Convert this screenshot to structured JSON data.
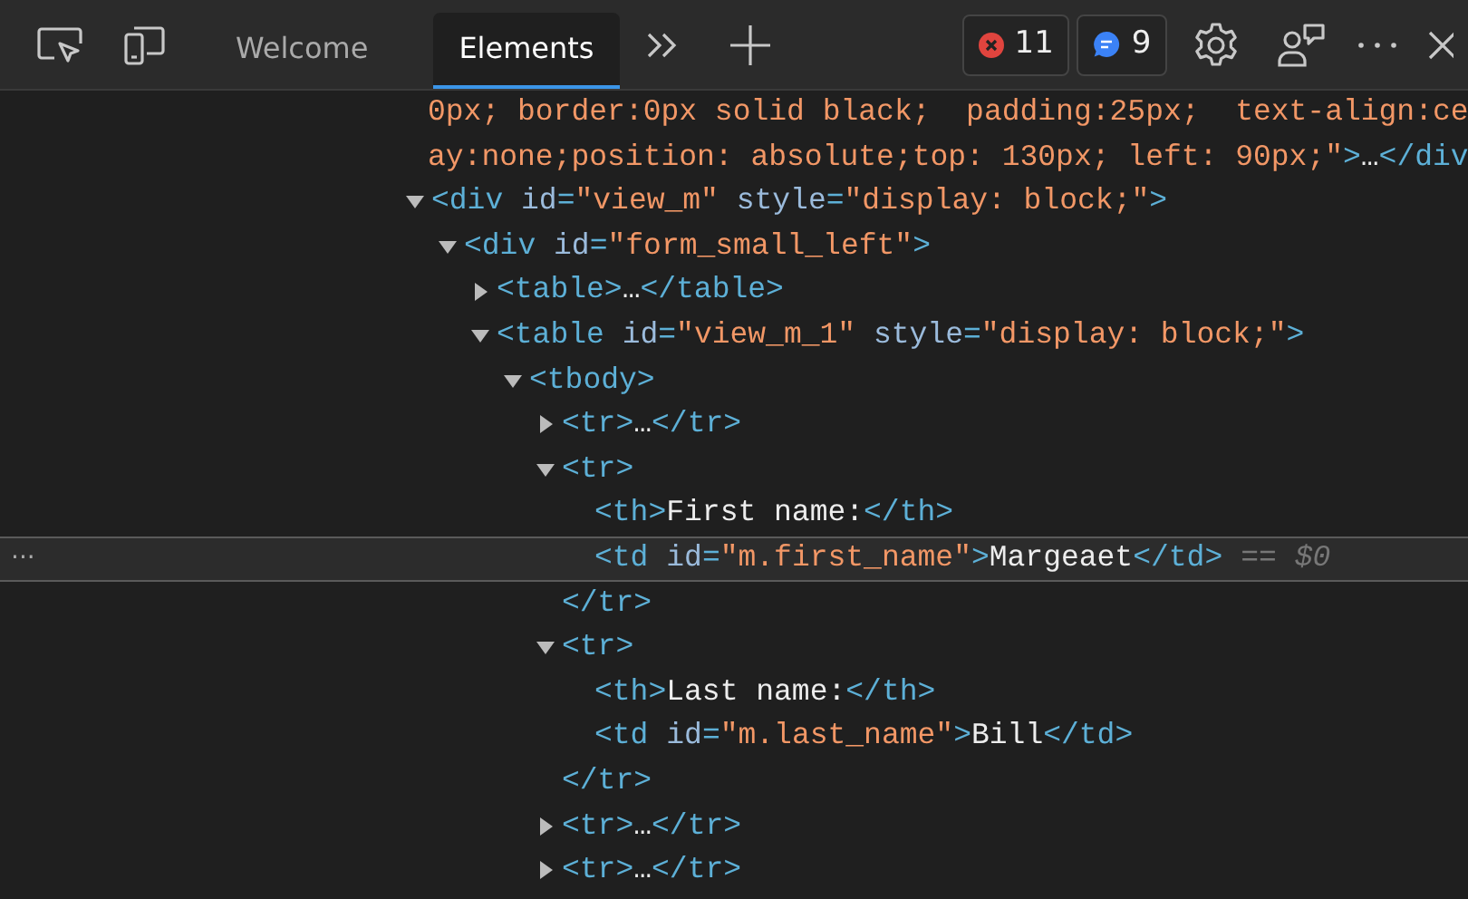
{
  "toolbar": {
    "tabs": [
      {
        "label": "Welcome",
        "selected": false
      },
      {
        "label": "Elements",
        "selected": true
      }
    ],
    "errors": "11",
    "messages": "9"
  },
  "wrapped_lines": [
    [
      {
        "kind": "value",
        "text": "0px; border:0px solid black;  padding:25px;  text-align:ce"
      }
    ],
    [
      {
        "kind": "value",
        "text": "ay:none;position: absolute;top: 130px; left: 90px;\""
      },
      {
        "kind": "tag",
        "text": ">"
      },
      {
        "kind": "text",
        "text": "…"
      },
      {
        "kind": "tag",
        "text": "</div"
      }
    ]
  ],
  "nodes": [
    {
      "selected": false,
      "expanded": true,
      "open": [
        {
          "kind": "tag",
          "text": "<div"
        },
        {
          "kind": "attr",
          "text": " id"
        },
        {
          "kind": "tag",
          "text": "="
        },
        {
          "kind": "value",
          "text": "\"view_m\""
        },
        {
          "kind": "attr",
          "text": " style"
        },
        {
          "kind": "tag",
          "text": "="
        },
        {
          "kind": "value",
          "text": "\"display: block;\""
        },
        {
          "kind": "tag",
          "text": ">"
        }
      ],
      "children": [
        {
          "selected": false,
          "expanded": true,
          "open": [
            {
              "kind": "tag",
              "text": "<div"
            },
            {
              "kind": "attr",
              "text": " id"
            },
            {
              "kind": "tag",
              "text": "="
            },
            {
              "kind": "value",
              "text": "\"form_small_left\""
            },
            {
              "kind": "tag",
              "text": ">"
            }
          ],
          "children": [
            {
              "selected": false,
              "expanded": false,
              "open": [
                {
                  "kind": "tag",
                  "text": "<table>"
                },
                {
                  "kind": "text",
                  "text": "…"
                },
                {
                  "kind": "tag",
                  "text": "</table>"
                }
              ]
            },
            {
              "selected": false,
              "expanded": true,
              "open": [
                {
                  "kind": "tag",
                  "text": "<table"
                },
                {
                  "kind": "attr",
                  "text": " id"
                },
                {
                  "kind": "tag",
                  "text": "="
                },
                {
                  "kind": "value",
                  "text": "\"view_m_1\""
                },
                {
                  "kind": "attr",
                  "text": " style"
                },
                {
                  "kind": "tag",
                  "text": "="
                },
                {
                  "kind": "value",
                  "text": "\"display: block;\""
                },
                {
                  "kind": "tag",
                  "text": ">"
                }
              ],
              "children": [
                {
                  "selected": false,
                  "expanded": true,
                  "open": [
                    {
                      "kind": "tag",
                      "text": "<tbody>"
                    }
                  ],
                  "children": [
                    {
                      "selected": false,
                      "expanded": false,
                      "open": [
                        {
                          "kind": "tag",
                          "text": "<tr>"
                        },
                        {
                          "kind": "text",
                          "text": "…"
                        },
                        {
                          "kind": "tag",
                          "text": "</tr>"
                        }
                      ]
                    },
                    {
                      "selected": false,
                      "expanded": true,
                      "open": [
                        {
                          "kind": "tag",
                          "text": "<tr>"
                        }
                      ],
                      "children": [
                        {
                          "selected": false,
                          "open": [
                            {
                              "kind": "tag",
                              "text": "<th>"
                            },
                            {
                              "kind": "text",
                              "text": "First name:"
                            },
                            {
                              "kind": "tag",
                              "text": "</th>"
                            }
                          ]
                        },
                        {
                          "selected": true,
                          "more": "···",
                          "hint": "== $0",
                          "open": [
                            {
                              "kind": "tag",
                              "text": "<td"
                            },
                            {
                              "kind": "attr",
                              "text": " id"
                            },
                            {
                              "kind": "tag",
                              "text": "="
                            },
                            {
                              "kind": "value",
                              "text": "\"m.first_name\""
                            },
                            {
                              "kind": "tag",
                              "text": ">"
                            },
                            {
                              "kind": "text",
                              "text": "Margeaet"
                            },
                            {
                              "kind": "tag",
                              "text": "</td>"
                            }
                          ]
                        }
                      ],
                      "close": [
                        {
                          "kind": "tag",
                          "text": "</tr>"
                        }
                      ]
                    },
                    {
                      "selected": false,
                      "expanded": true,
                      "open": [
                        {
                          "kind": "tag",
                          "text": "<tr>"
                        }
                      ],
                      "children": [
                        {
                          "selected": false,
                          "open": [
                            {
                              "kind": "tag",
                              "text": "<th>"
                            },
                            {
                              "kind": "text",
                              "text": "Last name:"
                            },
                            {
                              "kind": "tag",
                              "text": "</th>"
                            }
                          ]
                        },
                        {
                          "selected": false,
                          "open": [
                            {
                              "kind": "tag",
                              "text": "<td"
                            },
                            {
                              "kind": "attr",
                              "text": " id"
                            },
                            {
                              "kind": "tag",
                              "text": "="
                            },
                            {
                              "kind": "value",
                              "text": "\"m.last_name\""
                            },
                            {
                              "kind": "tag",
                              "text": ">"
                            },
                            {
                              "kind": "text",
                              "text": "Bill"
                            },
                            {
                              "kind": "tag",
                              "text": "</td>"
                            }
                          ]
                        }
                      ],
                      "close": [
                        {
                          "kind": "tag",
                          "text": "</tr>"
                        }
                      ]
                    },
                    {
                      "selected": false,
                      "expanded": false,
                      "open": [
                        {
                          "kind": "tag",
                          "text": "<tr>"
                        },
                        {
                          "kind": "text",
                          "text": "…"
                        },
                        {
                          "kind": "tag",
                          "text": "</tr>"
                        }
                      ]
                    },
                    {
                      "selected": false,
                      "expanded": false,
                      "open": [
                        {
                          "kind": "tag",
                          "text": "<tr>"
                        },
                        {
                          "kind": "text",
                          "text": "…"
                        },
                        {
                          "kind": "tag",
                          "text": "</tr>"
                        }
                      ]
                    }
                  ]
                }
              ]
            }
          ]
        }
      ]
    }
  ]
}
